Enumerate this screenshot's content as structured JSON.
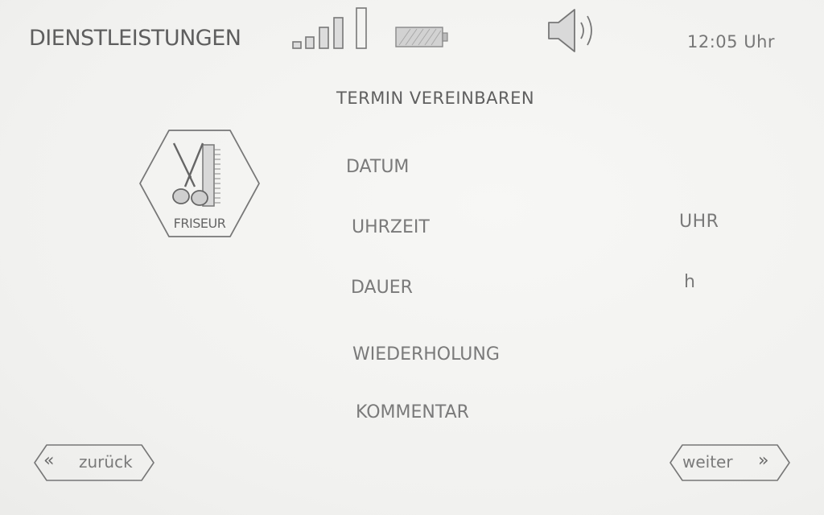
{
  "status_bar": {
    "app_title": "DIENSTLEISTUNGEN",
    "time": "12:05 Uhr",
    "signal_icon": "signal-strength-icon",
    "battery_icon": "battery-icon",
    "volume_icon": "speaker-volume-icon"
  },
  "page": {
    "title": "TERMIN VEREINBAREN"
  },
  "service": {
    "label": "FRISEUR",
    "icon": "scissors-comb-icon"
  },
  "form": {
    "fields": [
      {
        "label": "DATUM",
        "unit": ""
      },
      {
        "label": "UHRZEIT",
        "unit": "UHR"
      },
      {
        "label": "DAUER",
        "unit": "h"
      },
      {
        "label": "WIEDERHOLUNG",
        "unit": ""
      },
      {
        "label": "KOMMENTAR",
        "unit": ""
      }
    ]
  },
  "navigation": {
    "back_label": "zurück",
    "back_icon": "double-chevron-left-icon",
    "next_label": "weiter",
    "next_icon": "double-chevron-right-icon"
  },
  "colors": {
    "pencil": "#6e6e6e",
    "paper": "#f4f4f2"
  }
}
